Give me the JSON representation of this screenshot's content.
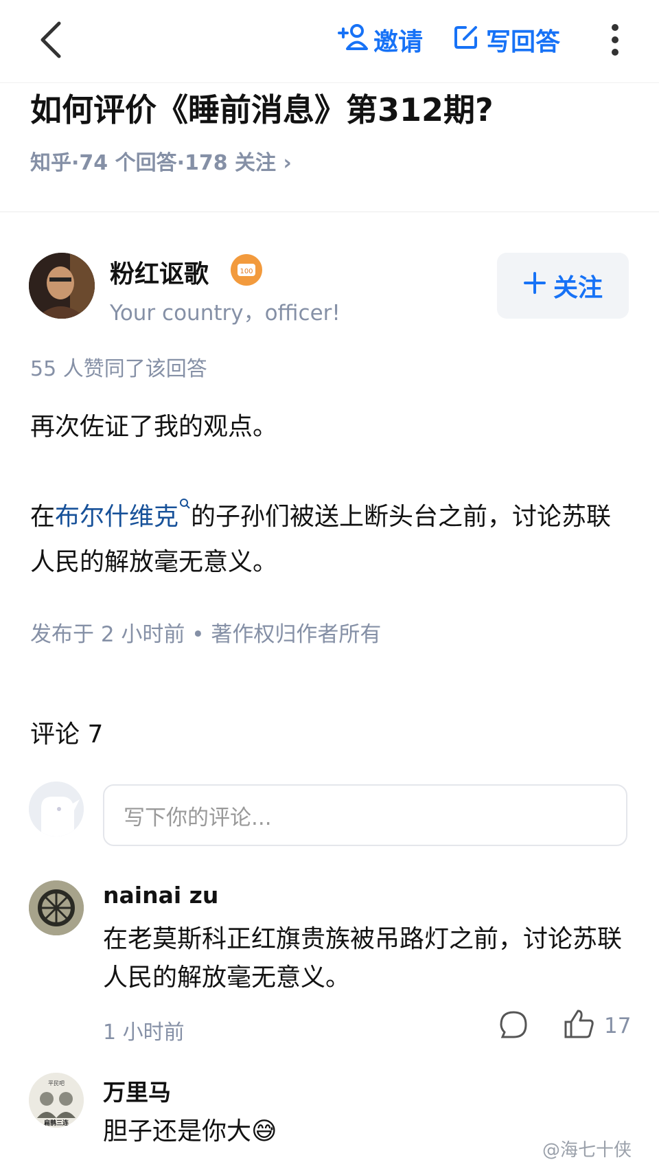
{
  "header": {
    "invite_label": "邀请",
    "write_label": "写回答"
  },
  "question": {
    "title": "如何评价《睡前消息》第312期?",
    "meta": "知乎·74 个回答·178 关注 ›"
  },
  "answer": {
    "author_name": "粉红讴歌",
    "author_bio": "Your country，officer!",
    "badge_text": "100",
    "follow_label": "关注",
    "votes": "55 人赞同了该回答",
    "para1": "再次佐证了我的观点。",
    "para2_prefix": "在",
    "para2_link": "布尔什维克",
    "para2_rest": "的子孙们被送上断头台之前，讨论苏联人民的解放毫无意义。",
    "published": "发布于 2 小时前 • 著作权归作者所有"
  },
  "comments": {
    "title": "评论 7",
    "input_placeholder": "写下你的评论...",
    "items": [
      {
        "name": "nainai zu",
        "text": "在老莫斯科正红旗贵族被吊路灯之前，讨论苏联人民的解放毫无意义。",
        "time": "1 小时前",
        "likes": "17"
      },
      {
        "name": "万里马",
        "text": "胆子还是你大😅",
        "avatar_text": "扁鹊三连",
        "avatar_small": "平民吧"
      }
    ]
  },
  "watermark": "@海七十侠",
  "colors": {
    "accent": "#1772f6",
    "link": "#175199",
    "muted": "#8590a6"
  }
}
